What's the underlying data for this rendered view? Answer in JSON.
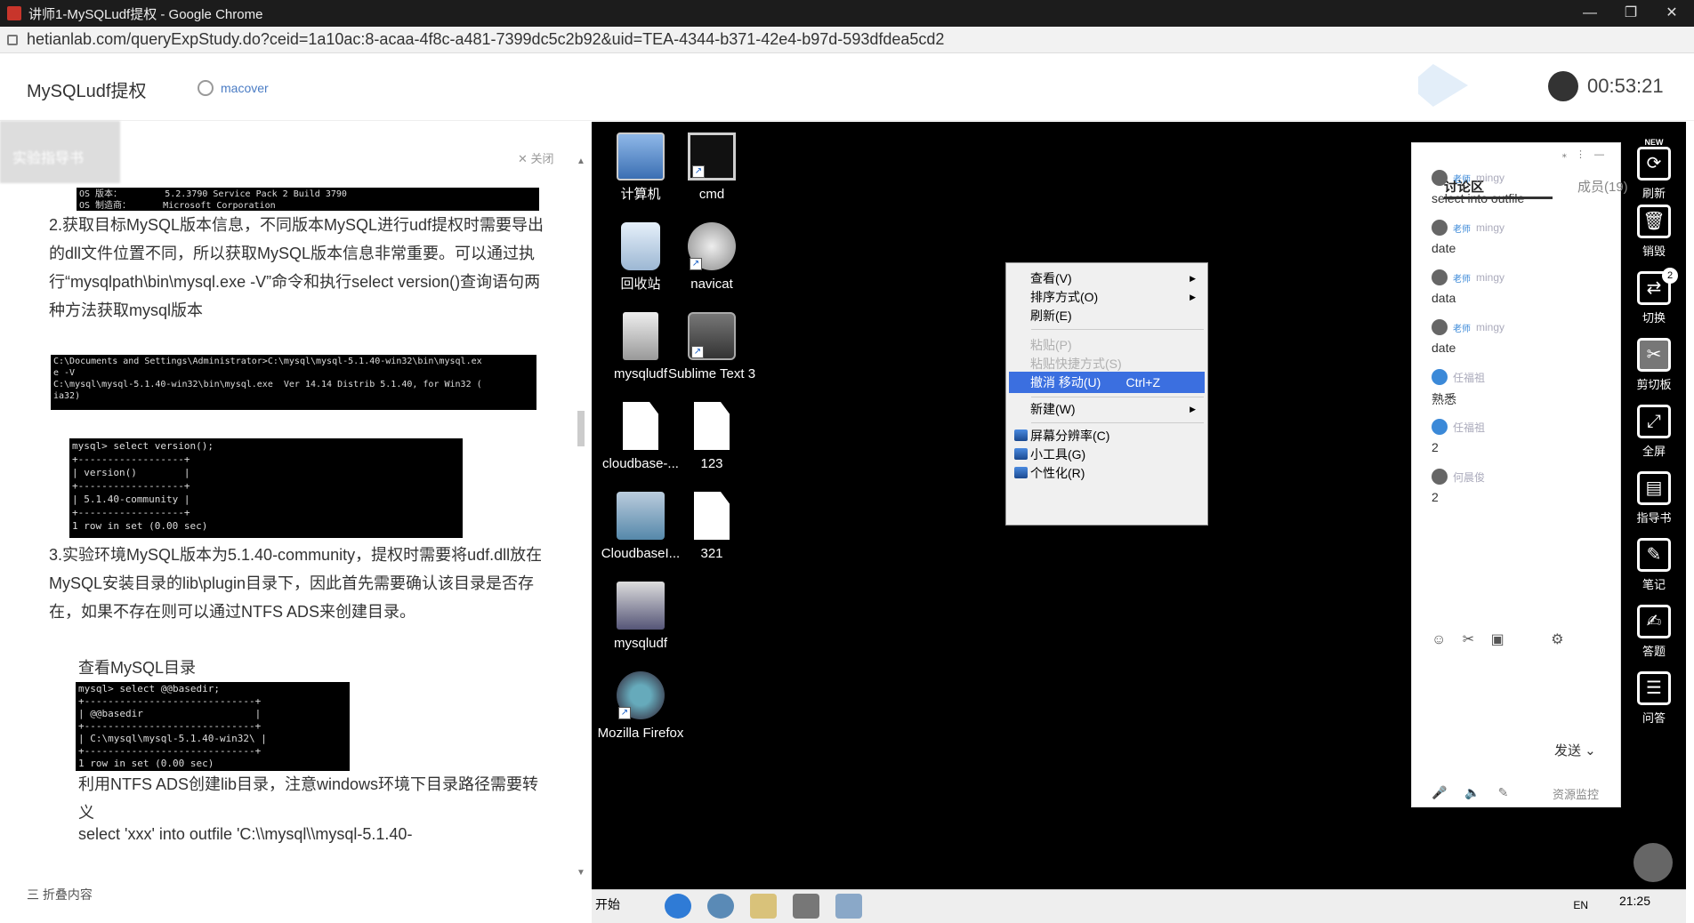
{
  "window": {
    "title": "讲师1-MySQLudf提权 - Google Chrome",
    "controls": [
      "—",
      "❐",
      "✕"
    ]
  },
  "address_bar": {
    "url": "hetianlab.com/queryExpStudy.do?ceid=1a10ac:8-acaa-4f8c-a481-7399dc5c2b92&uid=TEA-4344-b371-42e4-b97d-593dfdea5cd2"
  },
  "header": {
    "title": "MySQLudf提权",
    "username": "macover",
    "timer": "00:53:21"
  },
  "left_panel": {
    "tab_label": "实验指导书",
    "close_label": "✕ 关闭",
    "term1": "OS 版本：        5.2.3790 Service Pack 2 Build 3790\nOS 制造商：      Microsoft Corporation",
    "para2": "2.获取目标MySQL版本信息，不同版本MySQL进行udf提权时需要导出的dll文件位置不同，所以获取MySQL版本信息非常重要。可以通过执行“mysqlpath\\bin\\mysql.exe -V”命令和执行select version()查询语句两种方法获取mysql版本",
    "term2": "C:\\Documents and Settings\\Administrator>C:\\mysql\\mysql-5.1.40-win32\\bin\\mysql.ex\ne -V\nC:\\mysql\\mysql-5.1.40-win32\\bin\\mysql.exe  Ver 14.14 Distrib 5.1.40, for Win32 (\nia32)",
    "term3": "mysql> select version();\n+------------------+\n| version()        |\n+------------------+\n| 5.1.40-community |\n+------------------+\n1 row in set (0.00 sec)",
    "para3": "3.实验环境MySQL版本为5.1.40-community，提权时需要将udf.dll放在MySQL安装目录的lib\\plugin目录下，因此首先需要确认该目录是否存在，如果不存在则可以通过NTFS ADS来创建目录。",
    "para_check": "查看MySQL目录",
    "term4": "mysql> select @@basedir;\n+-----------------------------+\n| @@basedir                   |\n+-----------------------------+\n| C:\\mysql\\mysql-5.1.40-win32\\ |\n+-----------------------------+\n1 row in set (0.00 sec)",
    "para_ntfs": "利用NTFS ADS创建lib目录，注意windows环境下目录路径需要转义",
    "para_sql": "select 'xxx' into outfile 'C:\\\\mysql\\\\mysql-5.1.40-",
    "fold_label": "三 折叠内容"
  },
  "desktop_icons": [
    {
      "label": "计算机",
      "kind": "computer"
    },
    {
      "label": "cmd",
      "kind": "cmd"
    },
    {
      "label": "回收站",
      "kind": "bin"
    },
    {
      "label": "navicat",
      "kind": "navicat"
    },
    {
      "label": "mysqludf",
      "kind": "folder"
    },
    {
      "label": "Sublime Text 3",
      "kind": "sublime"
    },
    {
      "label": "cloudbase-...",
      "kind": "file"
    },
    {
      "label": "123",
      "kind": "file"
    },
    {
      "label": "CloudbaseI...",
      "kind": "cloud"
    },
    {
      "label": "321",
      "kind": "file"
    },
    {
      "label": "mysqludf",
      "kind": "mysql"
    },
    {
      "label": "Mozilla Firefox",
      "kind": "firefox"
    }
  ],
  "context_menu": {
    "view": "查看(V)",
    "sort": "排序方式(O)",
    "refresh": "刷新(E)",
    "paste": "粘贴(P)",
    "paste_shortcut": "粘贴快捷方式(S)",
    "undo_move": "撤消 移动(U)",
    "undo_hotkey": "Ctrl+Z",
    "new": "新建(W)",
    "resolution": "屏幕分辨率(C)",
    "gadgets": "小工具(G)",
    "personalize": "个性化(R)"
  },
  "chat": {
    "tab_discussion": "讨论区",
    "tab_members": "成员(19)",
    "messages": [
      {
        "role": "老师",
        "user": "mingy",
        "text": "select into outfile"
      },
      {
        "role": "老师",
        "user": "mingy",
        "text": "date"
      },
      {
        "role": "老师",
        "user": "mingy",
        "text": "data"
      },
      {
        "role": "老师",
        "user": "mingy",
        "text": "date"
      },
      {
        "role": "",
        "user": "任福祖",
        "text": "熟悉"
      },
      {
        "role": "",
        "user": "任福祖",
        "text": "2"
      },
      {
        "role": "",
        "user": "何晨俊",
        "text": "2"
      }
    ],
    "send_label": "发送",
    "monitor_label": "资源监控"
  },
  "right_toolbar": [
    {
      "label": "刷新",
      "glyph": "⟳"
    },
    {
      "label": "销毁",
      "glyph": "🗑"
    },
    {
      "label": "切换",
      "glyph": "⇄"
    },
    {
      "label": "剪切板",
      "glyph": "✂"
    },
    {
      "label": "全屏",
      "glyph": "⤢"
    },
    {
      "label": "指导书",
      "glyph": "▤"
    },
    {
      "label": "笔记",
      "glyph": "✎"
    },
    {
      "label": "答题",
      "glyph": "✍"
    },
    {
      "label": "问答",
      "glyph": "☰"
    }
  ],
  "right_toolbar_badge": "2",
  "right_toolbar_new": "NEW",
  "taskbar": {
    "start": "开始",
    "lang": "EN",
    "clock": "21:25"
  }
}
